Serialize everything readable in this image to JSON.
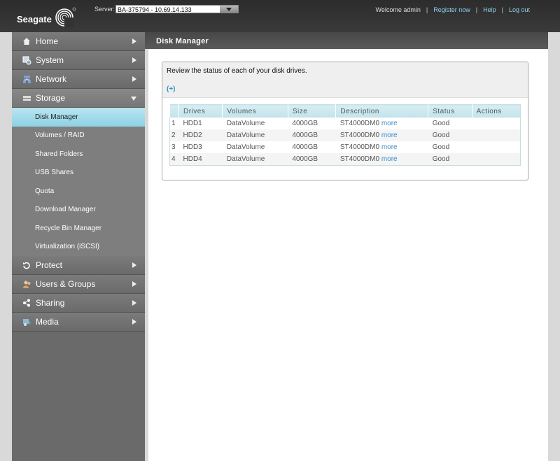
{
  "brand": {
    "name": "Seagate"
  },
  "header": {
    "server_label": "Server:",
    "server_value": "BA-375794 - 10.69.14.133",
    "welcome": "Welcome admin",
    "links": [
      "Register now",
      "Help",
      "Log out"
    ]
  },
  "sidebar": {
    "items": [
      {
        "label": "Home",
        "icon": "home-icon"
      },
      {
        "label": "System",
        "icon": "system-icon"
      },
      {
        "label": "Network",
        "icon": "network-icon"
      },
      {
        "label": "Storage",
        "icon": "storage-icon"
      }
    ],
    "storage_subitems": [
      "Disk Manager",
      "Volumes / RAID",
      "Shared Folders",
      "USB Shares",
      "Quota",
      "Download Manager",
      "Recycle Bin Manager",
      "Virtualization (iSCSI)"
    ],
    "items_after": [
      {
        "label": "Protect",
        "icon": "protect-icon"
      },
      {
        "label": "Users & Groups",
        "icon": "users-icon"
      },
      {
        "label": "Sharing",
        "icon": "share-icon"
      },
      {
        "label": "Media",
        "icon": "media-icon"
      }
    ]
  },
  "main": {
    "title": "Disk Manager",
    "description": "Review the status of each of your disk drives.",
    "expand": "(+)",
    "table": {
      "headers": [
        "Drives",
        "Volumes",
        "Size",
        "Description",
        "Status",
        "Actions"
      ],
      "rows": [
        {
          "num": "1",
          "drive": "HDD1",
          "volume": "DataVolume",
          "size": "4000GB",
          "desc": "ST4000DM0",
          "more": "more",
          "status": "Good"
        },
        {
          "num": "2",
          "drive": "HDD2",
          "volume": "DataVolume",
          "size": "4000GB",
          "desc": "ST4000DM0",
          "more": "more",
          "status": "Good"
        },
        {
          "num": "3",
          "drive": "HDD3",
          "volume": "DataVolume",
          "size": "4000GB",
          "desc": "ST4000DM0",
          "more": "more",
          "status": "Good"
        },
        {
          "num": "4",
          "drive": "HDD4",
          "volume": "DataVolume",
          "size": "4000GB",
          "desc": "ST4000DM0",
          "more": "more",
          "status": "Good"
        }
      ]
    }
  }
}
